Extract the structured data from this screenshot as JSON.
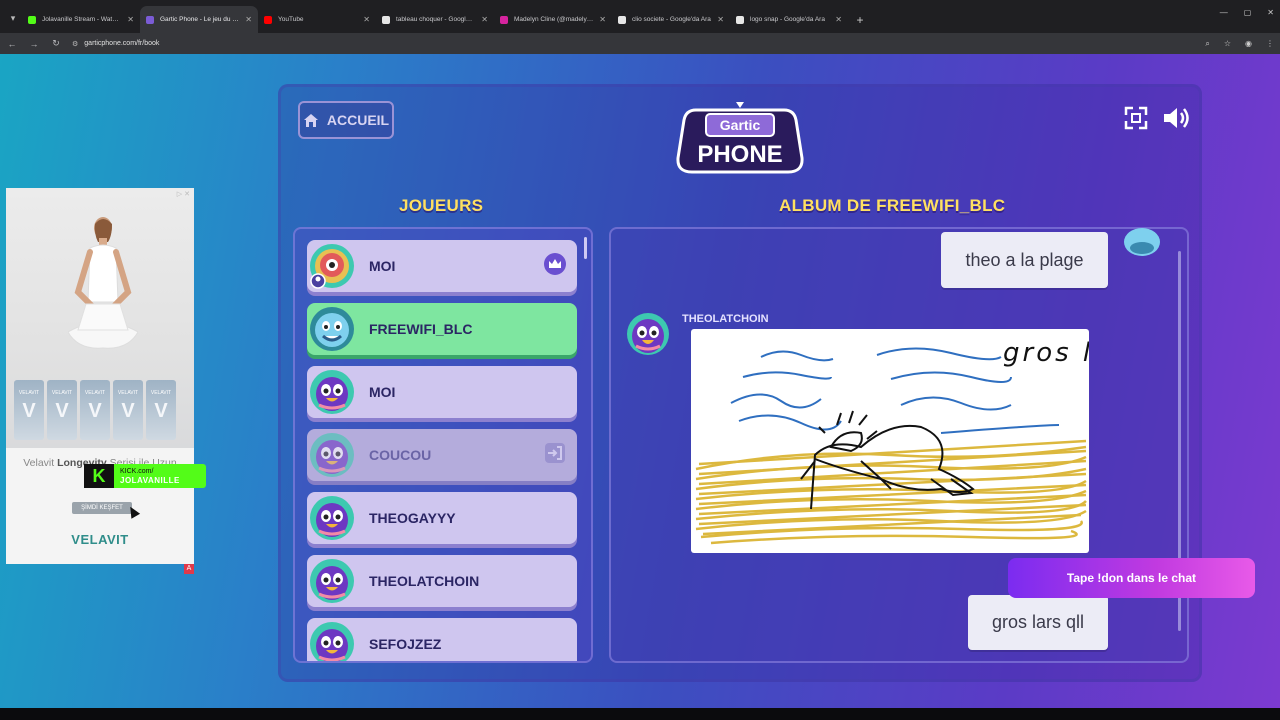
{
  "browser": {
    "tabs": [
      {
        "label": "Jolavanille Stream - Watch Live",
        "color": "#53fc18",
        "active": false
      },
      {
        "label": "Gartic Phone - Le jeu du téléphone",
        "color": "#7b5cd6",
        "active": true
      },
      {
        "label": "YouTube",
        "color": "#ff0000",
        "active": false
      },
      {
        "label": "tableau choquer - Google'da Ara",
        "color": "#e6e6e6",
        "active": false
      },
      {
        "label": "Madelyn Cline (@madelyncline)",
        "color": "#d6249f",
        "active": false
      },
      {
        "label": "clio societe - Google'da Ara",
        "color": "#e6e6e6",
        "active": false
      },
      {
        "label": "logo snap - Google'da Ara",
        "color": "#e6e6e6",
        "active": false
      }
    ],
    "url": "garticphone.com/fr/book"
  },
  "ad": {
    "text_prefix": "Velavit ",
    "text_bold": "Longevity",
    "text_suffix": " Serisi ile Uzun ve",
    "cta": "ŞİMDİ KEŞFET",
    "brand": "VELAVIT",
    "bottle_label": "VELAVIT",
    "badge": "A"
  },
  "kick_overlay": {
    "line1": "KICK.com/",
    "line2": "JOLAVANILLE"
  },
  "header": {
    "home_label": "ACCUEIL",
    "logo_line1": "Gartic",
    "logo_line2": "PHONE"
  },
  "players_heading": "JOUEURS",
  "album_heading": "ALBUM DE FREEWIFI_BLC",
  "players": [
    {
      "name": "MOI",
      "state": "host"
    },
    {
      "name": "FREEWIFI_BLC",
      "state": "current"
    },
    {
      "name": "MOI",
      "state": "normal"
    },
    {
      "name": "COUCOU",
      "state": "left"
    },
    {
      "name": "THEOGAYYY",
      "state": "normal"
    },
    {
      "name": "THEOLATCHOIN",
      "state": "normal"
    },
    {
      "name": "SEFOJZEZ",
      "state": "normal"
    }
  ],
  "album": {
    "first_text": "theo a la plage",
    "drawing_author": "THEOLATCHOIN",
    "drawing_caption": "gros lard",
    "last_text": "gros lars qll"
  },
  "chat_tip": "Tape !don dans le chat",
  "colors": {
    "heading": "#ffe061",
    "current_player": "#7ee6a0",
    "player_card": "#cfc6ef"
  }
}
